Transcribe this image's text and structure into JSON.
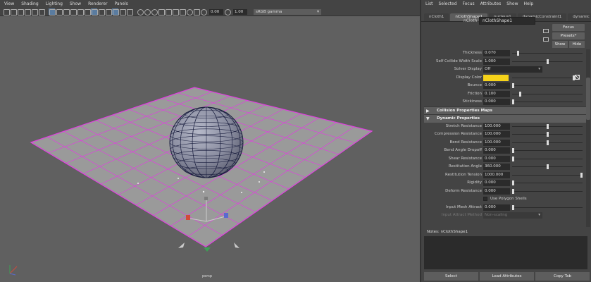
{
  "viewport": {
    "menu": [
      "View",
      "Shading",
      "Lighting",
      "Show",
      "Renderer",
      "Panels"
    ],
    "field1": "0.00",
    "field2": "1.00",
    "color_space": "sRGB gamma",
    "camera_label": "persp"
  },
  "attribute_editor": {
    "menu": [
      "List",
      "Selected",
      "Focus",
      "Attributes",
      "Show",
      "Help"
    ],
    "tabs": [
      "nCloth1",
      "nClothShape1",
      "nucleus1",
      "dynamicConstraint1",
      "dynamic"
    ],
    "node_type_label": "nCloth:",
    "node_name": "nClothShape1",
    "focus_label": "Focus",
    "presets_label": "Presets*",
    "show_label": "Show",
    "hide_label": "Hide",
    "rows": [
      {
        "label": "Thickness",
        "value": "0.070",
        "slider": 0.07
      },
      {
        "label": "Self Collide Width Scale",
        "value": "1.000",
        "slider": 0.5
      },
      {
        "label": "Solver Display",
        "select": "Off"
      },
      {
        "label": "Display Color",
        "color": "#f6d31a"
      },
      {
        "label": "Bounce",
        "value": "0.000",
        "slider": 0.0
      },
      {
        "label": "Friction",
        "value": "0.100",
        "slider": 0.1
      },
      {
        "label": "Stickiness",
        "value": "0.000",
        "slider": 0.0
      }
    ],
    "section_collision_maps": "Collision Properties Maps",
    "section_dynamic": "Dynamic Properties",
    "dynamic_rows": [
      {
        "label": "Stretch Resistance",
        "value": "100.000",
        "slider": 0.5
      },
      {
        "label": "Compression Resistance",
        "value": "100.000",
        "slider": 0.5
      },
      {
        "label": "Bend Resistance",
        "value": "100.000",
        "slider": 0.5
      },
      {
        "label": "Bend Angle Dropoff",
        "value": "0.000",
        "slider": 0.0
      },
      {
        "label": "Shear Resistance",
        "value": "0.000",
        "slider": 0.0
      },
      {
        "label": "Restitution Angle",
        "value": "360.000",
        "slider": 0.5
      },
      {
        "label": "Restitution Tension",
        "value": "1000.000",
        "slider": 1.0
      },
      {
        "label": "Rigidity",
        "value": "0.000",
        "slider": 0.0
      },
      {
        "label": "Deform Resistance",
        "value": "0.000",
        "slider": 0.0
      }
    ],
    "use_polygon_shells": "Use Polygon Shells",
    "input_mesh_attract_label": "Input Mesh Attract",
    "input_mesh_attract_value": "0.000",
    "input_attract_method_label": "Input Attract Method",
    "input_attract_method_value": "Non-scaling",
    "notes_label": "Notes: nClothShape1",
    "bottom_buttons": [
      "Select",
      "Load Attributes",
      "Copy Tab"
    ]
  }
}
